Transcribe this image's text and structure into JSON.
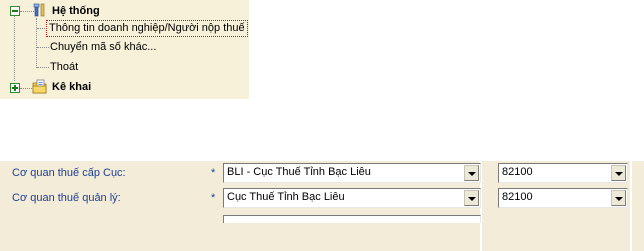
{
  "tree": {
    "system": {
      "label": "Hệ thống",
      "children": [
        "Thông tin doanh nghiệp/Người nộp thuế",
        "Chuyển mã số khác...",
        "Thoát"
      ]
    },
    "declare": {
      "label": "Kê khai"
    }
  },
  "form": {
    "rows": [
      {
        "label": "Cơ quan thuế cấp Cục:",
        "required": "*",
        "value": "BLI - Cục Thuế Tỉnh Bạc Liêu",
        "code": "82100"
      },
      {
        "label": "Cơ quan thuế quản lý:",
        "required": "*",
        "value": "Cục Thuế Tỉnh Bạc Liêu",
        "code": "82100"
      }
    ]
  },
  "colors": {
    "tree_bg": "#f7f1d9",
    "form_bg": "#f3ecd8",
    "label_blue": "#1e3f96",
    "selection": "#cc1111"
  },
  "icons": [
    "minus-box-icon",
    "system-tools-icon",
    "plus-box-icon",
    "folder-document-icon"
  ]
}
